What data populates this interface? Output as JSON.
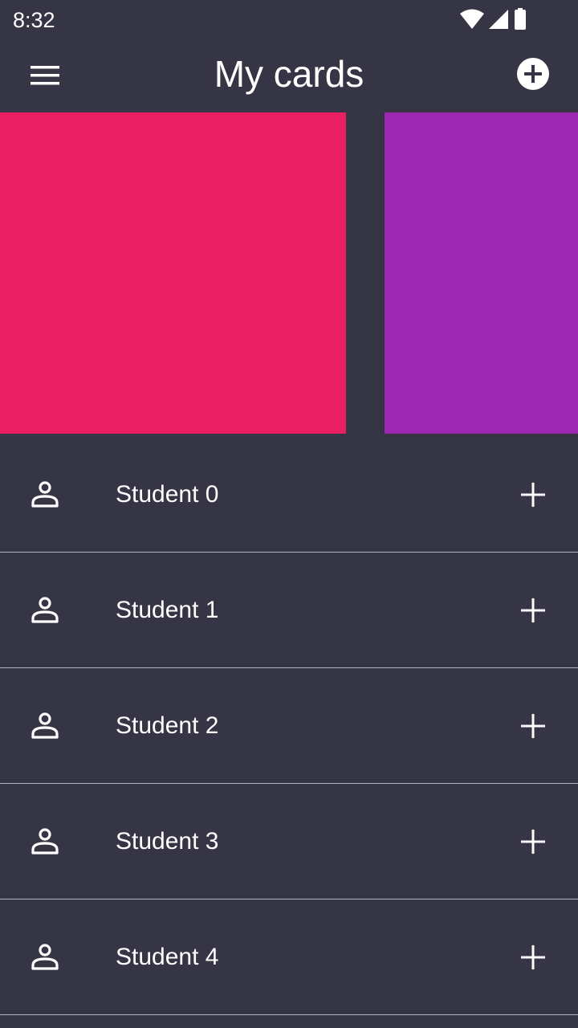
{
  "status_bar": {
    "time": "8:32",
    "icons": [
      "wifi-icon",
      "cell-signal-icon",
      "battery-icon"
    ]
  },
  "app_bar": {
    "title": "My cards",
    "menu_icon": "hamburger-menu-icon",
    "add_icon": "add-circle-icon"
  },
  "colors": {
    "background": "#353545",
    "card_0": "#E91E63",
    "card_1": "#9C27B0",
    "divider": "#B4B4BD",
    "text": "#FFFFFF"
  },
  "students": [
    {
      "name": "Student 0"
    },
    {
      "name": "Student 1"
    },
    {
      "name": "Student 2"
    },
    {
      "name": "Student 3"
    },
    {
      "name": "Student 4"
    }
  ]
}
